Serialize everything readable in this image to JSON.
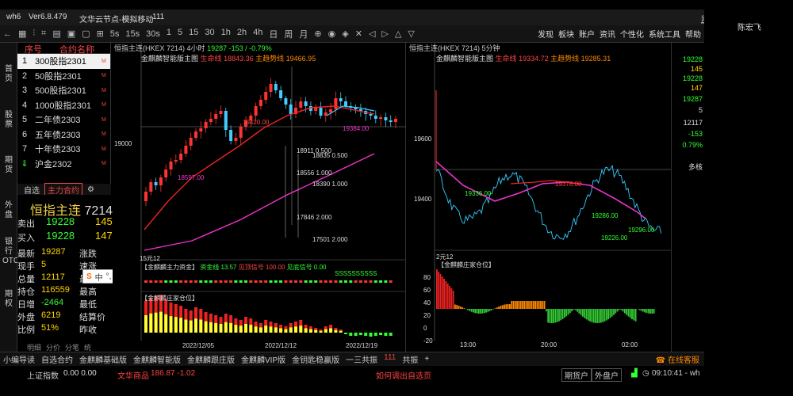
{
  "titlebar": {
    "app": "wh6",
    "version": "Ver6.8.479",
    "server": "文华云节点-模拟移动",
    "badge": "111"
  },
  "toolbar": {
    "items": [
      "1",
      "5",
      "15",
      "30",
      "1h",
      "2h",
      "4h",
      "日",
      "周",
      "月"
    ],
    "right": [
      "发现",
      "板块",
      "账户",
      "资讯",
      "个性化",
      "系统工具",
      "帮助"
    ],
    "new_badge": "NEW"
  },
  "user": "陈宏飞",
  "leftbar": [
    "首页",
    "股票",
    "期货",
    "外盘",
    "银行OTC",
    "期权"
  ],
  "quote_list": {
    "headers": [
      "序号",
      "合约名称"
    ],
    "rows": [
      [
        "1",
        "300股指2301"
      ],
      [
        "2",
        "50股指2301"
      ],
      [
        "3",
        "500股指2301"
      ],
      [
        "4",
        "1000股指2301"
      ],
      [
        "5",
        "二年债2303"
      ],
      [
        "6",
        "五年债2303"
      ],
      [
        "7",
        "十年债2303"
      ],
      [
        "8",
        "沪金2302"
      ]
    ],
    "arrow": "⇓",
    "sup": "M"
  },
  "subtabs": {
    "tab1": "自选",
    "tab2": "主力合约"
  },
  "detail": {
    "name": "恒指主连",
    "code": "7214",
    "rows": [
      {
        "k1": "卖出",
        "v1": "19228",
        "v2": "145"
      },
      {
        "k1": "买入",
        "v1": "19228",
        "v2": "147"
      },
      {
        "k1": "最新",
        "v1": "19287",
        "k2": "涨跌"
      },
      {
        "k1": "现手",
        "v1": "5",
        "k2": "速涨"
      },
      {
        "k1": "总量",
        "v1": "12117",
        "k2": "最高"
      },
      {
        "k1": "持仓",
        "v1": "116559",
        "k2": "最高"
      },
      {
        "k1": "日增",
        "v1": "-2464",
        "k2": "最低"
      },
      {
        "k1": "外盘",
        "v1": "6219",
        "k2": "结算价"
      },
      {
        "k1": "比例",
        "v1": "51%",
        "k2": "昨收"
      }
    ],
    "bottom_tabs": [
      "明细",
      "分价",
      "分笔",
      "统"
    ]
  },
  "chart1": {
    "title": "恒指主连(HKEX 7214)",
    "period": "4小时",
    "price": "19287",
    "change": "-153 / -0.79%",
    "ma_name": "金麒麟智能版主图",
    "ma1_label": "生命线",
    "ma1": "18843.36",
    "ma2_label": "主趋势线",
    "ma2": "19466.95",
    "yaxis": [
      "19000"
    ],
    "annot": [
      "19420.00",
      "19384.00",
      "18597.00"
    ],
    "fib": [
      [
        "18911",
        "0.500"
      ],
      [
        "18835",
        "0.500"
      ],
      [
        "18556",
        "1.000"
      ],
      [
        "18390",
        "1.000"
      ],
      [
        "17846",
        "2.000"
      ],
      [
        "17501",
        "2.000"
      ]
    ],
    "sub1_tag": "15元12",
    "sub1_title": "【金麒麟主力资金】",
    "sub1_k": "资金线",
    "sub1_v": "13.57",
    "sub1_k2": "见顶信号",
    "sub1_v2": "100.00",
    "sub1_k3": "见底信号",
    "sub1_v3": "0.00",
    "sub1_marks": "SSSSSSSSSS",
    "sub2_title": "【金麒麟庄家仓位】",
    "xaxis": [
      "2022/12/05",
      "2022/12/12",
      "2022/12/19"
    ]
  },
  "chart2": {
    "title": "恒指主连(HKEX 7214)",
    "period": "5分钟",
    "ma_name": "金麒麟智能版主图",
    "ma1_label": "生命线",
    "ma1": "19334.72",
    "ma2_label": "主趋势线",
    "ma2": "19285.31",
    "yaxis": [
      "19600",
      "19400"
    ],
    "annot": [
      "19336.00",
      "19378.00",
      "19286.00",
      "19296.00",
      "19226.00"
    ],
    "sub_tag": "2元12",
    "sub_title": "【金麒麟庄家仓位】",
    "sub_y": [
      "80",
      "60",
      "40",
      "20",
      "0",
      "-20"
    ],
    "xaxis": [
      "13:00",
      "20:00",
      "02:00"
    ]
  },
  "side_prices": [
    {
      "v": "19228",
      "c": "#3f3"
    },
    {
      "v": "145",
      "c": "#ffd400"
    },
    {
      "v": "19228",
      "c": "#3f3"
    },
    {
      "v": "147",
      "c": "#ffd400"
    },
    {
      "v": "19287",
      "c": "#3f3"
    },
    {
      "v": "5",
      "c": "#ddd"
    },
    {
      "v": "12117",
      "c": "#ddd"
    },
    {
      "v": "-153",
      "c": "#3f3"
    },
    {
      "v": "0.79%",
      "c": "#3f3"
    },
    {
      "v": "多核",
      "c": "#ddd"
    }
  ],
  "bottom_tabs": [
    "小编导读",
    "自选合约",
    "金麒麟基础版",
    "金麒麟智能版",
    "金麒麟跟庄版",
    "金麒麟VIP版",
    "金钥匙稳赢版",
    "一三共振",
    "111",
    "共振"
  ],
  "service": "在线客服",
  "status": {
    "index": "上证指数",
    "idxval": "0.00  0.00",
    "ticker": "文华商品",
    "tickval": "186.87  -1.02",
    "link": "如何调出自选页",
    "acct1": "期货户",
    "acct2": "外盘户",
    "time": "09:10:41 - wh"
  }
}
